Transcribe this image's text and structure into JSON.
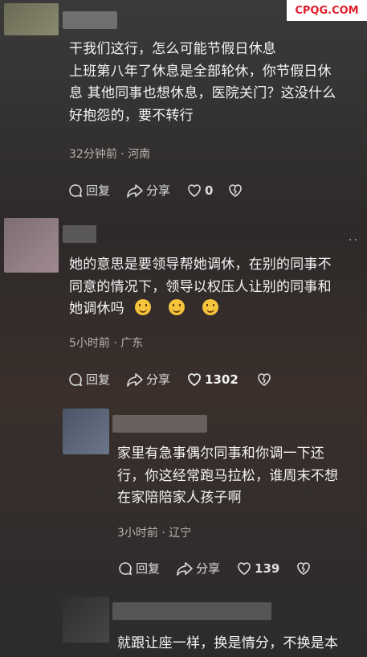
{
  "watermark": "CPQG.COM",
  "comments": [
    {
      "lines": [
        "干我们这行，怎么可能节假日休息",
        "上班第八年了休息是全部轮休，你节假日休",
        "息 其他同事也想休息，医院关门？这没什么",
        "好抱怨的，要不转行"
      ],
      "meta": "32分钟前 · 河南",
      "reply_label": "回复",
      "share_label": "分享",
      "like_count": "0"
    },
    {
      "lines": [
        "她的意思是要领导帮她调休，在别的同事不",
        "同意的情况下，领导以权压人让别的同事和",
        "她调休吗"
      ],
      "meta": "5小时前 · 广东",
      "reply_label": "回复",
      "share_label": "分享",
      "like_count": "1302",
      "more_label": "··"
    },
    {
      "lines": [
        "家里有急事偶尔同事和你调一下还",
        "行，你这经常跑马拉松，谁周末不想",
        "在家陪陪家人孩子啊"
      ],
      "meta": "3小时前 · 辽宁",
      "reply_label": "回复",
      "share_label": "分享",
      "like_count": "139"
    },
    {
      "lines": [
        "就跟让座一样，换是情分，不换是本"
      ]
    }
  ]
}
